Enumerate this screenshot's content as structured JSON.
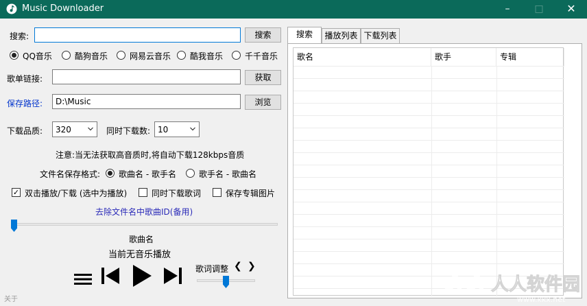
{
  "window": {
    "title": "Music Downloader",
    "minimize": "–",
    "maximize": "□",
    "close": "✕"
  },
  "search": {
    "label": "搜索:",
    "value": "",
    "button": "搜索"
  },
  "sources": [
    {
      "label": "QQ音乐",
      "selected": true
    },
    {
      "label": "酷狗音乐",
      "selected": false
    },
    {
      "label": "网易云音乐",
      "selected": false
    },
    {
      "label": "酷我音乐",
      "selected": false
    },
    {
      "label": "千千音乐",
      "selected": false
    }
  ],
  "playlist": {
    "label": "歌单链接:",
    "value": "",
    "button": "获取"
  },
  "save_path": {
    "label": "保存路径:",
    "value": "D:\\Music",
    "button": "浏览"
  },
  "quality": {
    "label": "下载品质:",
    "value": "320"
  },
  "concurrent": {
    "label": "同时下载数:",
    "value": "10"
  },
  "notice": "注意:当无法获取高音质时,将自动下载128kbps音质",
  "filename_format": {
    "label": "文件名保存格式:",
    "options": [
      {
        "label": "歌曲名 - 歌手名",
        "selected": true
      },
      {
        "label": "歌手名 - 歌曲名",
        "selected": false
      }
    ]
  },
  "checkboxes": [
    {
      "label": "双击播放/下载 (选中为播放)",
      "checked": true
    },
    {
      "label": "同时下载歌词",
      "checked": false
    },
    {
      "label": "保存专辑图片",
      "checked": false
    }
  ],
  "remove_id_link": "去除文件名中歌曲ID(备用)",
  "player": {
    "progress": 0.0,
    "song_title": "歌曲名",
    "status": "当前无音乐播放",
    "lyric_adjust_label": "歌词调整",
    "lyric_prev": "❮",
    "lyric_next": "❯",
    "lyric_offset": 0.5
  },
  "tabs": [
    {
      "label": "搜索",
      "active": true
    },
    {
      "label": "播放列表",
      "active": false
    },
    {
      "label": "下载列表",
      "active": false
    }
  ],
  "results_table": {
    "columns": [
      "歌名",
      "歌手",
      "专辑"
    ],
    "rows": []
  },
  "about": "关于",
  "watermark": {
    "text": "人人软件园",
    "url": "www.kkx.net"
  },
  "colors": {
    "titlebar": "#0b6a5a",
    "accent": "#0078d7",
    "path_label": "#0033cc",
    "link": "#2a2ab8"
  }
}
